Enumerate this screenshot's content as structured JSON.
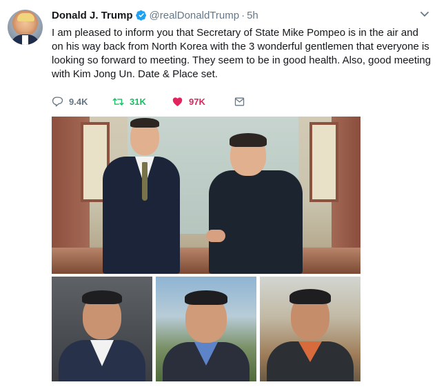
{
  "tweet": {
    "author_name": "Donald J. Trump",
    "handle": "@realDonaldTrump",
    "separator": "·",
    "time": "5h",
    "verified": true,
    "text": "I am pleased to inform you that Secretary of State Mike Pompeo is in the air and on his way back from North Korea with the 3 wonderful gentlemen that everyone is looking so forward to meeting. They seem to be in good health. Also, good meeting with Kim Jong Un. Date & Place set."
  },
  "actions": {
    "reply": {
      "icon": "reply-icon",
      "count": "9.4K"
    },
    "retweet": {
      "icon": "retweet-icon",
      "count": "31K"
    },
    "like": {
      "icon": "heart-icon",
      "count": "97K"
    },
    "direct_message": {
      "icon": "envelope-icon"
    }
  },
  "colors": {
    "text": "#14171a",
    "secondary": "#657786",
    "verified": "#1da1f2",
    "retweet": "#17bf63",
    "like": "#e0245e"
  },
  "media": {
    "photos": [
      "main-handshake-photo",
      "portrait-left",
      "portrait-center",
      "portrait-right"
    ]
  }
}
